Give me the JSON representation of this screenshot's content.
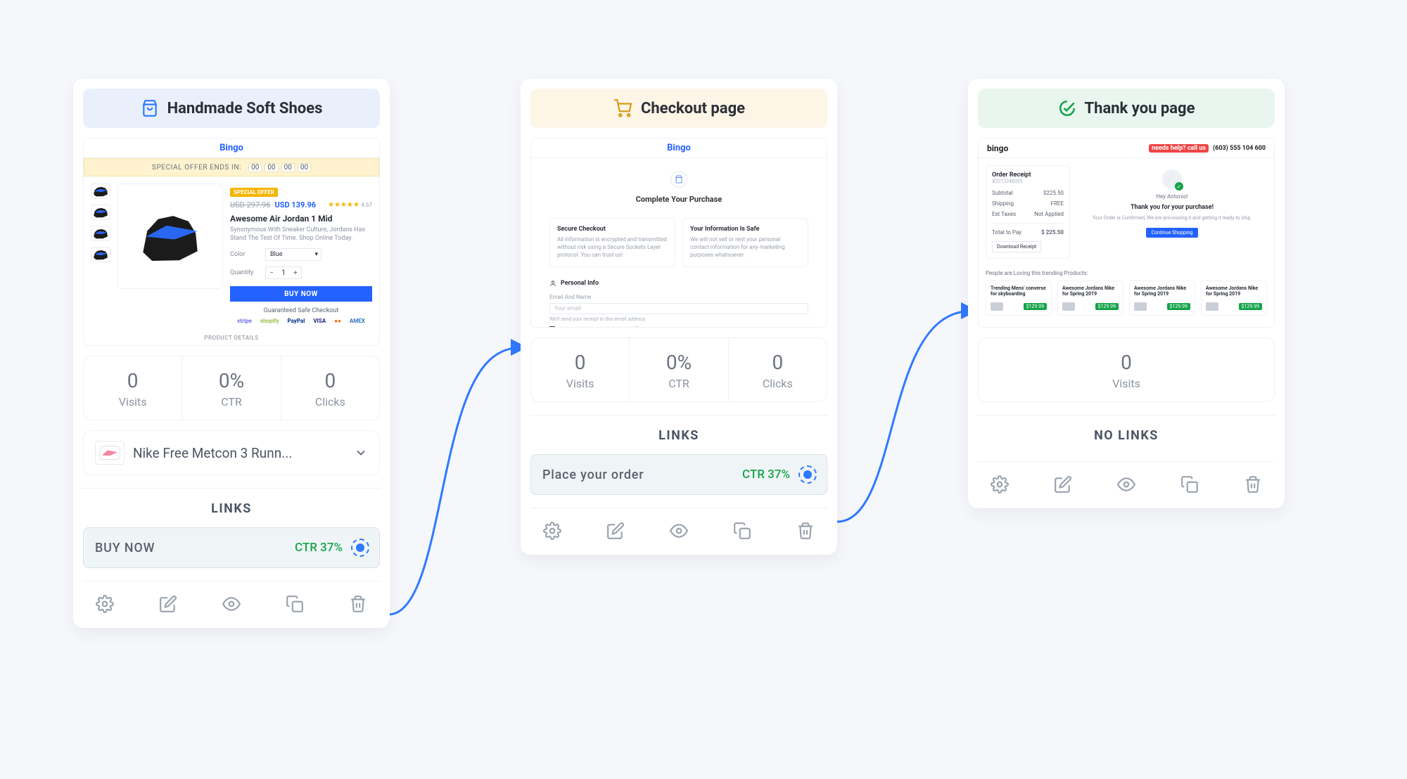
{
  "cards": [
    {
      "header": {
        "title": "Handmade Soft Shoes"
      },
      "preview_product": {
        "brand": "Bingo",
        "offer_label": "SPECIAL OFFER ENDS IN:",
        "timer": [
          "00",
          "00",
          "00",
          "00"
        ],
        "badge": "SPECIAL OFFER",
        "old_price": "USD 297.96",
        "new_price": "USD 139.96",
        "stars": "★★★★★",
        "rating": "4.67",
        "title": "Awesome Air Jordan 1 Mid",
        "desc": "Synonymous With Sneaker Culture, Jordans Has Stand The Test Of Time. Shop Online Today.",
        "color_label": "Color",
        "color_value": "Blue",
        "qty_label": "Quantity",
        "qty_value": "1",
        "buy_label": "BUY NOW",
        "safe": "Guaranteed Safe Checkout",
        "payments": [
          "stripe",
          "shopify",
          "PayPal",
          "VISA",
          "●●",
          "AMEX"
        ],
        "details": "PRODUCT DETAILS"
      },
      "stats": {
        "visits_val": "0",
        "visits_lbl": "Visits",
        "ctr_val": "0%",
        "ctr_lbl": "CTR",
        "clicks_val": "0",
        "clicks_lbl": "Clicks"
      },
      "product_selector": {
        "name": "Nike Free Metcon 3 Runn..."
      },
      "links_title": "LINKS",
      "link": {
        "name": "BUY NOW",
        "ctr": "CTR 37%"
      }
    },
    {
      "header": {
        "title": "Checkout page"
      },
      "preview_checkout": {
        "brand": "Bingo",
        "title": "Complete Your Purchase",
        "box1_h": "Secure Checkout",
        "box1_p": "All information is encrypted and transmitted without risk using a Secure Sockets Layer protocol. You can trust us!",
        "box2_h": "Your Information Is Safe",
        "box2_p": "We will not sell or rent your personal contact information for any marketing purposes whatsoever.",
        "pinfo_title": "Personal Info",
        "email_lbl": "Email And Name",
        "email_ph": "Your email",
        "email_note": "We'll send your receipt to this email address",
        "check": "Send me news and exclusive offers"
      },
      "stats": {
        "visits_val": "0",
        "visits_lbl": "Visits",
        "ctr_val": "0%",
        "ctr_lbl": "CTR",
        "clicks_val": "0",
        "clicks_lbl": "Clicks"
      },
      "links_title": "LINKS",
      "link": {
        "name": "Place your order",
        "ctr": "CTR 37%"
      }
    },
    {
      "header": {
        "title": "Thank you page"
      },
      "preview_thankyou": {
        "brand": "bingo",
        "help": "Needs Help? Call us",
        "phone": "(603) 555 104 600",
        "receipt_title": "Order Receipt",
        "order_no": "#2012348095",
        "lines": [
          {
            "k": "Subtotal",
            "v": "$225.50"
          },
          {
            "k": "Shipping",
            "v": "FREE"
          },
          {
            "k": "Est Taxes",
            "v": "Not Applied"
          }
        ],
        "total_k": "Total to Pay",
        "total_v": "$ 225.50",
        "download": "Download Receipt",
        "hi": "Hey Antonio!",
        "thanks": "Thank you for your purchase!",
        "sub": "Your Order is Confirmed, We are processing it and getting it ready to ship.",
        "btn": "Continue Shopping",
        "reco_hdr": "People are Loving this trending Products:",
        "recos": [
          {
            "t": "Trending Mens' converse for skyboarding",
            "p": "$129.99"
          },
          {
            "t": "Awesome Jordans Nike for Spring 2019",
            "p": "$129.99"
          },
          {
            "t": "Awesome Jordans Nike for Spring 2019",
            "p": "$129.99"
          },
          {
            "t": "Awesome Jordans Nike for Spring 2019",
            "p": "$129.99"
          }
        ]
      },
      "stats_single": {
        "visits_val": "0",
        "visits_lbl": "Visits"
      },
      "nolinks": "NO LINKS"
    }
  ]
}
